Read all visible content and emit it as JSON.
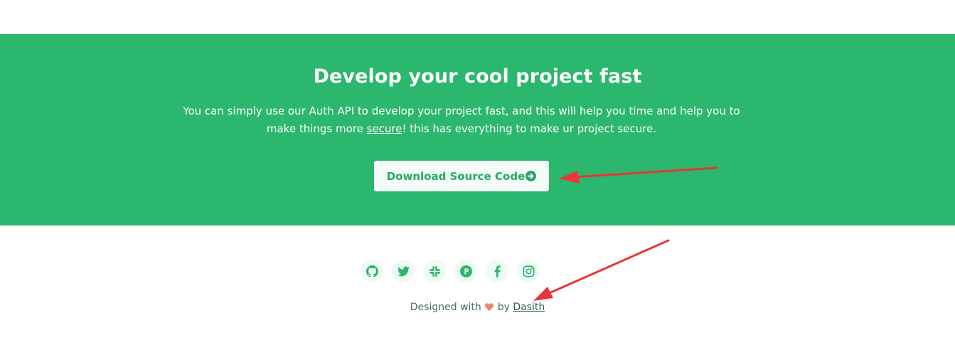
{
  "cta": {
    "title": "Develop your cool project fast",
    "text_before": "You can simply use our Auth API to develop your project fast, and this will help you time and help you to make things more ",
    "link_text": "secure",
    "text_after": "! this has everything to make ur project secure.",
    "button_label": "Download Source Code",
    "button_icon": "arrow-circle-right-icon",
    "background_color": "#2bb76d"
  },
  "footer": {
    "social_icons": [
      "github-icon",
      "twitter-icon",
      "slack-icon",
      "product-hunt-icon",
      "facebook-icon",
      "instagram-icon"
    ],
    "credit_prefix": "Designed with",
    "credit_by": "by",
    "author": "Dasith"
  },
  "annotations": {
    "arrow_color": "#e8363a"
  }
}
